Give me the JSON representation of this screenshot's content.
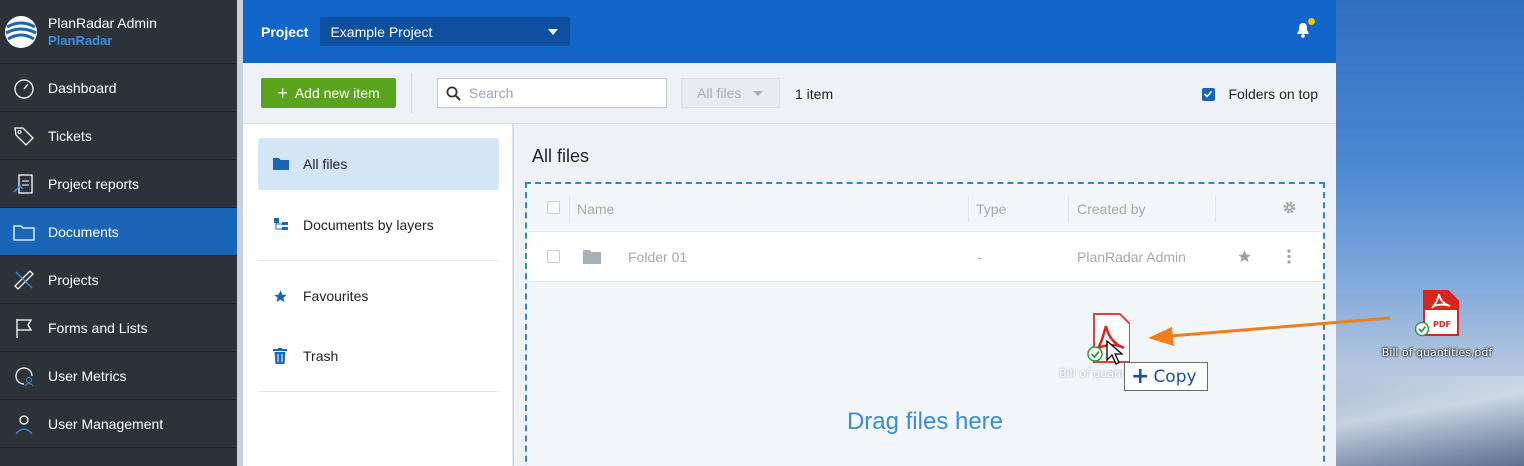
{
  "sidebar": {
    "brand_name": "PlanRadar Admin",
    "brand_sub": "PlanRadar",
    "items": [
      {
        "label": "Dashboard",
        "icon": "gauge-icon",
        "active": false
      },
      {
        "label": "Tickets",
        "icon": "tag-icon",
        "active": false
      },
      {
        "label": "Project reports",
        "icon": "report-icon",
        "active": false
      },
      {
        "label": "Documents",
        "icon": "folder-icon",
        "active": true
      },
      {
        "label": "Projects",
        "icon": "ruler-pencil-icon",
        "active": false
      },
      {
        "label": "Forms and Lists",
        "icon": "flag-icon",
        "active": false
      },
      {
        "label": "User Metrics",
        "icon": "user-metrics-icon",
        "active": false
      },
      {
        "label": "User Management",
        "icon": "user-icon",
        "active": false
      }
    ]
  },
  "topbar": {
    "project_label": "Project",
    "project_value": "Example Project",
    "notification_icon": "bell-icon",
    "notification_dot_color": "#f5c400"
  },
  "toolbar": {
    "add_label": "Add new item",
    "search_placeholder": "Search",
    "filter_value": "All files",
    "item_count": "1 item",
    "folders_on_top_label": "Folders on top",
    "folders_on_top_checked": true
  },
  "folders": {
    "items": [
      {
        "label": "All files",
        "icon": "folder-icon",
        "active": true
      },
      {
        "label": "Documents by layers",
        "icon": "layers-icon",
        "active": false
      },
      {
        "label": "Favourites",
        "icon": "star-icon",
        "active": false
      },
      {
        "label": "Trash",
        "icon": "trash-icon",
        "active": false
      }
    ]
  },
  "main": {
    "title": "All files",
    "columns": [
      "Name",
      "Type",
      "Created by"
    ],
    "rows": [
      {
        "name": "Folder 01",
        "type": "-",
        "created_by": "PlanRadar Admin"
      }
    ],
    "drop_text": "Drag files here"
  },
  "drag": {
    "ghost_label": "Bill of quantities.pdf",
    "tooltip_label": "Copy",
    "desktop_file_label": "Bill of quantities.pdf",
    "file_badge": "PDF",
    "arrow_color": "#f07f1a"
  },
  "colors": {
    "accent": "#1366c9",
    "sidebar_bg": "#2b3238",
    "add_button": "#5aa41d",
    "pdf_red": "#d7261e"
  }
}
